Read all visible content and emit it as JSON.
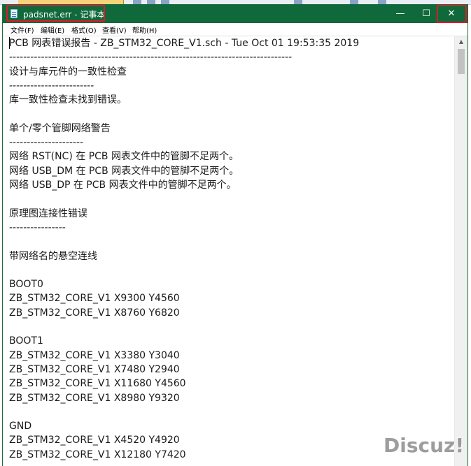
{
  "window": {
    "title": "padsnet.err - 记事本",
    "min_glyph": "—",
    "max_glyph": "☐",
    "close_glyph": "✕"
  },
  "menu": {
    "items": [
      {
        "label": "文件(F)"
      },
      {
        "label": "编辑(E)"
      },
      {
        "label": "格式(O)"
      },
      {
        "label": "查看(V)"
      },
      {
        "label": "帮助(H)"
      }
    ]
  },
  "document": {
    "lines": [
      "PCB 网表错误报告 - ZB_STM32_CORE_V1.sch - Tue Oct 01 19:53:35 2019",
      "--------------------------------------------------------------------------------",
      "设计与库元件的一致性检查",
      "------------------------",
      "库一致性检查未找到错误。",
      "",
      "单个/零个管脚网络警告",
      "---------------------",
      "网络 RST(NC) 在 PCB 网表文件中的管脚不足两个。",
      "网络 USB_DM 在 PCB 网表文件中的管脚不足两个。",
      "网络 USB_DP 在 PCB 网表文件中的管脚不足两个。",
      "",
      "原理图连接性错误",
      "----------------",
      "",
      "带网络名的悬空连线",
      "",
      "BOOT0",
      "ZB_STM32_CORE_V1 X9300  Y4560",
      "ZB_STM32_CORE_V1 X8760  Y6820",
      "",
      "BOOT1",
      "ZB_STM32_CORE_V1 X3380  Y3040",
      "ZB_STM32_CORE_V1 X7480  Y2940",
      "ZB_STM32_CORE_V1 X11680 Y4560",
      "ZB_STM32_CORE_V1 X8980  Y9320",
      "",
      "GND",
      "ZB_STM32_CORE_V1 X4520  Y4920",
      "ZB_STM32_CORE_V1 X12180 Y7420"
    ]
  },
  "watermark": {
    "text": "Discuz!"
  },
  "colors": {
    "titlebar": "#10693a",
    "highlight": "#e0192a"
  }
}
